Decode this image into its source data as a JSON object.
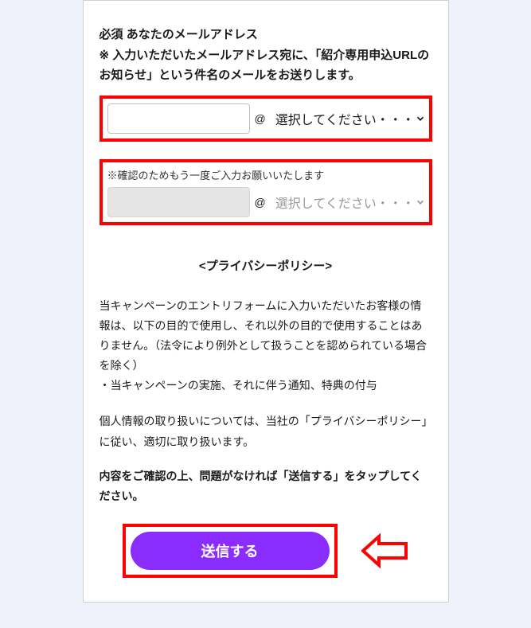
{
  "label": {
    "required": "必須",
    "title": "あなたのメールアドレス",
    "description": "※ 入力いただいたメールアドレス宛に、「紹介専用申込URLのお知らせ」という件名のメールをお送りします。"
  },
  "email": {
    "at": "@",
    "domain_placeholder": "選択してください・・・",
    "confirm_label": "※確認のためもう一度ご入力お願いいたします"
  },
  "policy": {
    "title": "<プライバシーポリシー>",
    "body": "当キャンペーンのエントリフォームに入力いただいたお客様の情報は、以下の目的で使用し、それ以外の目的で使用することはありません。（法令により例外として扱うことを認められている場合を除く）\n・当キャンペーンの実施、それに伴う通知、特典の付与",
    "note": "個人情報の取り扱いについては、当社の「プライバシーポリシー」に従い、適切に取り扱います。",
    "instruction": "内容をご確認の上、問題がなければ「送信する」をタップしてください。"
  },
  "submit": {
    "label": "送信する"
  }
}
